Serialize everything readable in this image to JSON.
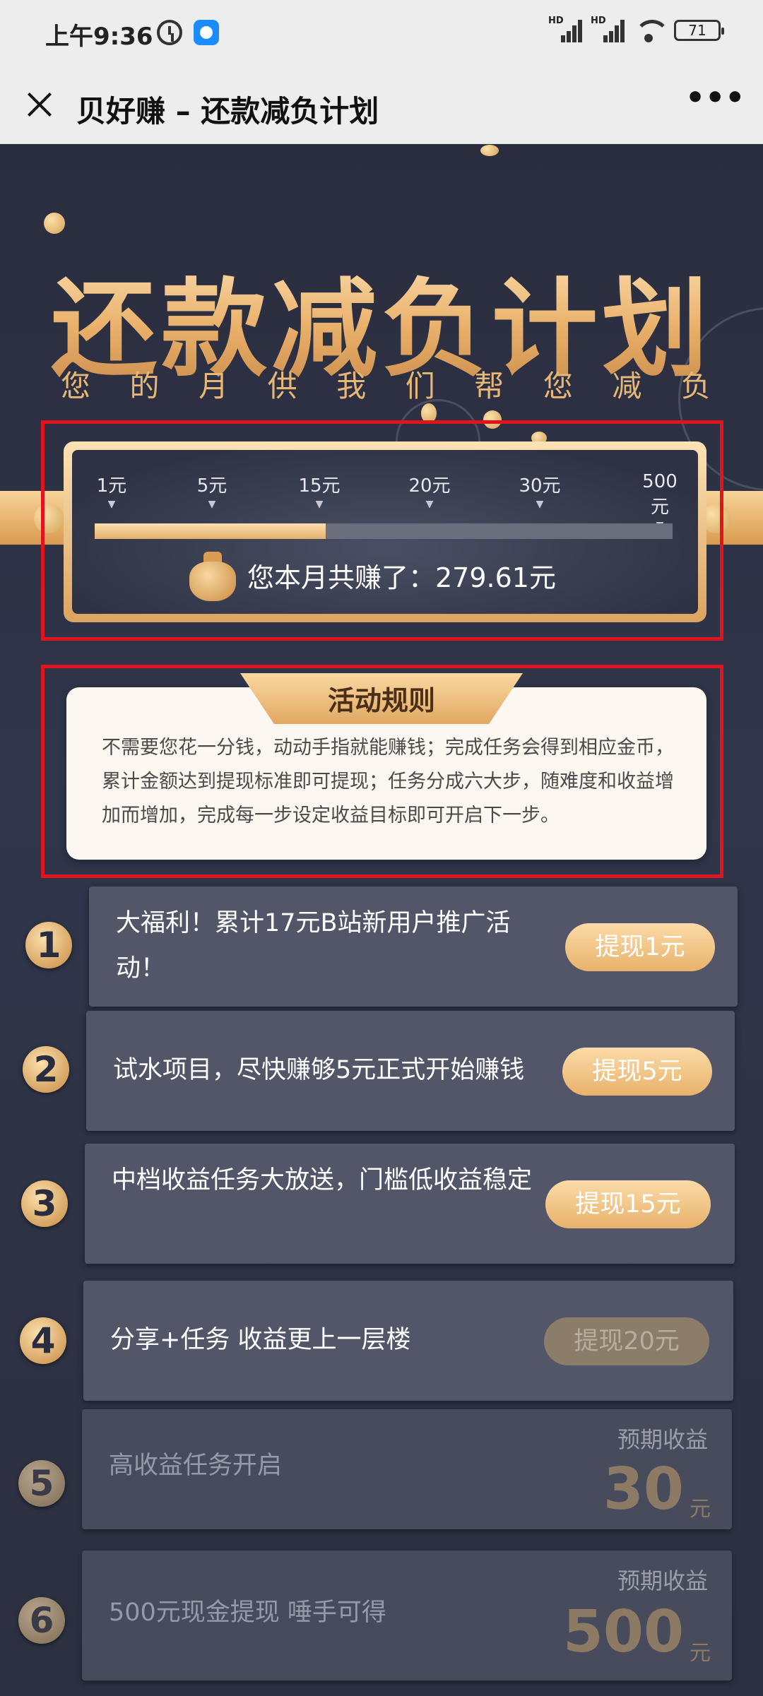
{
  "status_bar": {
    "time": "上午9:36",
    "battery": "71",
    "hd1": "HD",
    "hd2": "HD"
  },
  "nav": {
    "title": "贝好赚 – 还款减负计划",
    "more": "•••"
  },
  "hero": {
    "title": "还款减负计划",
    "subtitle": [
      "您",
      "的",
      "月",
      "供",
      "我",
      "们",
      "帮",
      "您",
      "减",
      "负"
    ]
  },
  "progress": {
    "ticks": [
      "1元",
      "5元",
      "15元",
      "20元",
      "30元",
      "500元"
    ],
    "fill_fraction": 0.4,
    "earned_text": "您本月共赚了：279.61元"
  },
  "rules": {
    "title": "活动规则",
    "text": "不需要您花一分钱，动动手指就能赚钱；完成任务会得到相应金币，累计金额达到提现标准即可提现；任务分成六大步，随难度和收益增加而增加，完成每一步设定收益目标即可开启下一步。"
  },
  "steps": [
    {
      "num": "1",
      "text": "大福利！累计17元B站新用户推广活动！",
      "button": "提现1元"
    },
    {
      "num": "2",
      "text": "试水项目，尽快赚够5元正式开始赚钱",
      "button": "提现5元"
    },
    {
      "num": "3",
      "text": "中档收益任务大放送，门槛低收益稳定",
      "button": "提现15元"
    },
    {
      "num": "4",
      "text": "分享+任务 收益更上一层楼",
      "button": "提现20元"
    },
    {
      "num": "5",
      "text": "高收益任务开启",
      "expected_label": "预期收益",
      "expected_value": "30",
      "unit": "元"
    },
    {
      "num": "6",
      "text": "500元现金提现 唾手可得",
      "expected_label": "预期收益",
      "expected_value": "500",
      "unit": "元"
    }
  ]
}
